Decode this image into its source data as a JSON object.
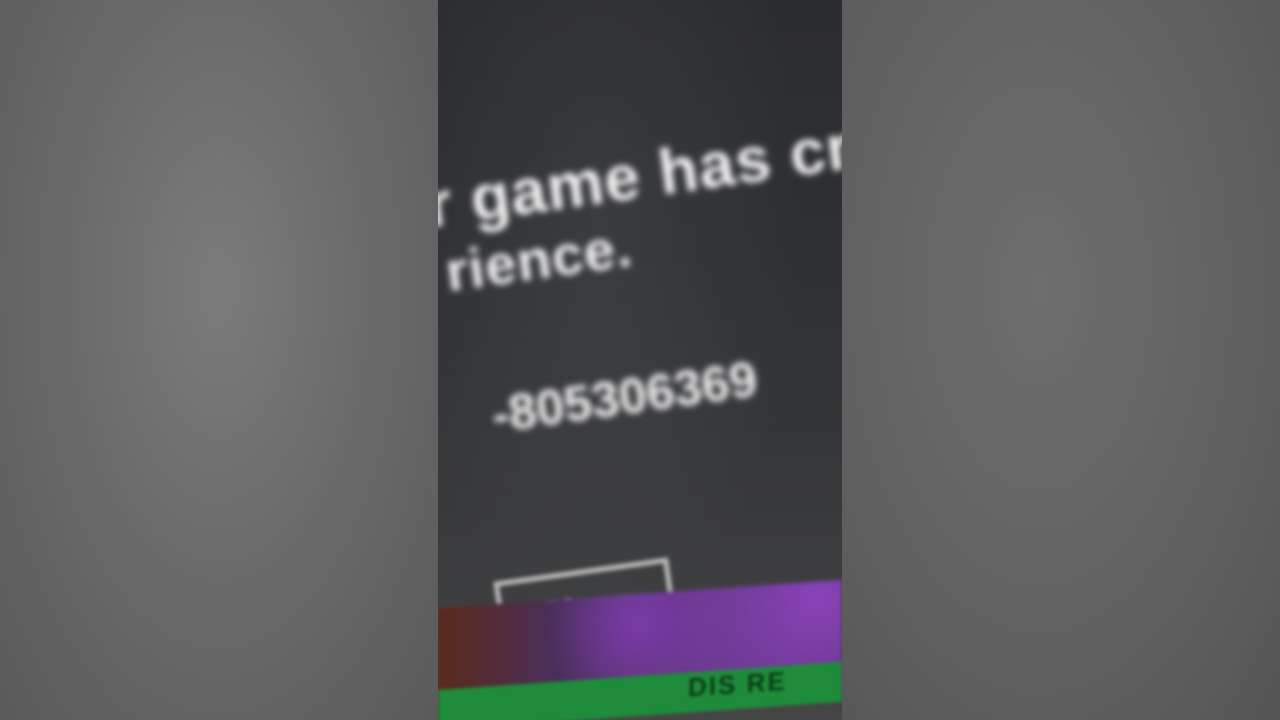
{
  "dialog": {
    "heading": "",
    "message_line1": "r game has cras",
    "message_line2": "rience.",
    "error_code": "-805306369",
    "close_label": "Close"
  },
  "background": {
    "banner_text": "DIS RE"
  },
  "colors": {
    "dialog_bg": "#2e3034",
    "text": "#f4f4f4",
    "button_border": "#bdbdbd",
    "banner": "#1e8c3a"
  }
}
